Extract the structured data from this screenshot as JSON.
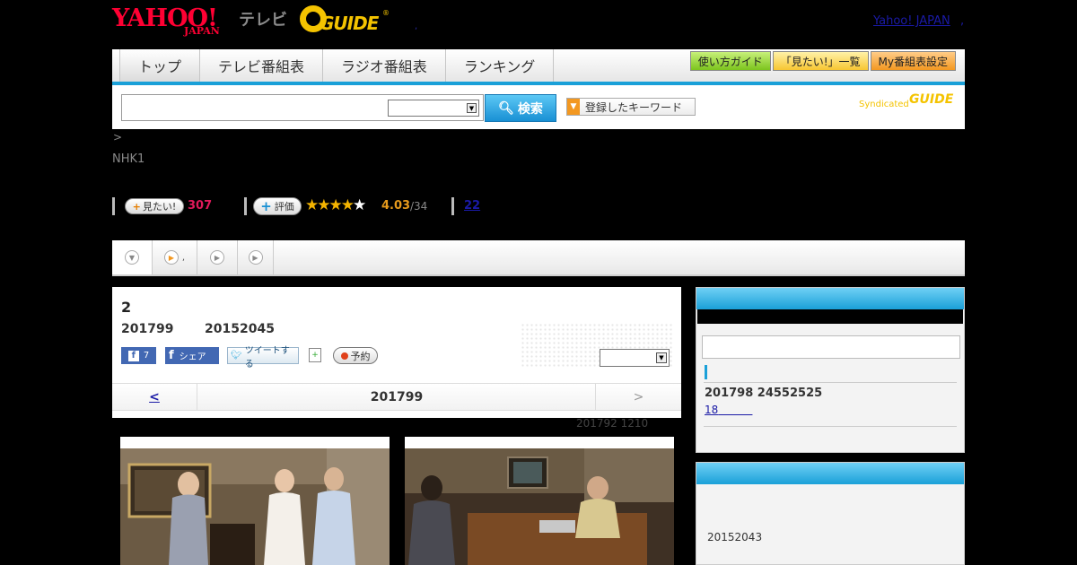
{
  "header": {
    "yahoo_logo": "YAHOO!",
    "yahoo_japan": "JAPAN",
    "tv_label": "テレビ",
    "gguide_logo": "GUIDE",
    "gguide_reg": "®",
    "dot": ",",
    "yahoo_japan_link": "Yahoo! JAPAN",
    "link_comma": ","
  },
  "nav": {
    "tabs": [
      "トップ",
      "テレビ番組表",
      "ラジオ番組表",
      "ランキング"
    ],
    "buttons": [
      "使い方ガイド",
      "「見たい!」一覧",
      "My番組表設定"
    ]
  },
  "search": {
    "button_label": "検索",
    "keyword_button": "登録したキーワード",
    "syndicated": "Syndicated",
    "syndicated_logo": "GUIDE"
  },
  "breadcrumb": ">",
  "channel": "NHK1",
  "stats": {
    "want_label": "見たい!",
    "want_count": "307",
    "rate_label": "評価",
    "rating_value": 4.03,
    "rating_display": "4.03",
    "rating_count": "/34",
    "review_count": "22"
  },
  "tabs": {
    "tab2_suffix": ","
  },
  "episode": {
    "title": "2",
    "date": "201799",
    "time": "20152045",
    "fb_like_count": "7",
    "fb_share": "シェア",
    "tweet": "ツイートする",
    "reserve": "予約"
  },
  "pager": {
    "prev": "<",
    "current": "201799",
    "next": ">"
  },
  "update_note": "201792  1210",
  "sidebar": {
    "info": "201798  24552525",
    "link": "18"
  },
  "sidebar2": {
    "text": "20152043"
  },
  "colors": {
    "accent_blue": "#1aa0d8",
    "want_pink": "#e0195a",
    "rating_orange": "#e69a1c",
    "gguide_yellow": "#f4c300",
    "yahoo_red": "#ff0033"
  }
}
